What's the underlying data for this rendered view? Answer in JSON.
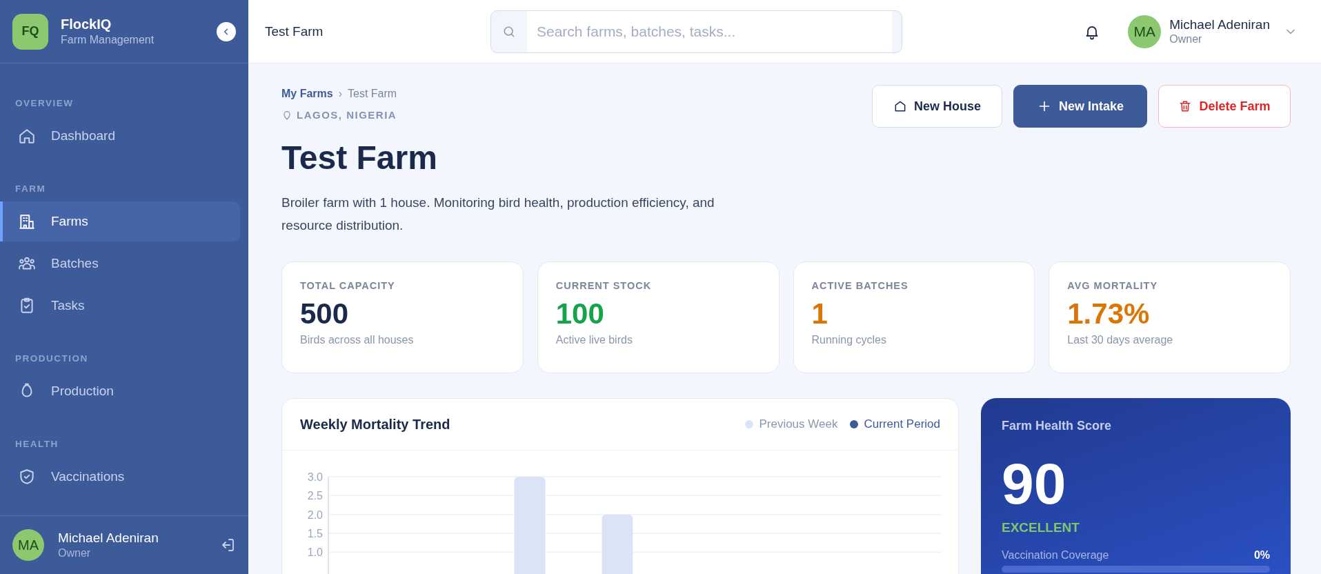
{
  "sidebar": {
    "brand": {
      "logo": "FQ",
      "name": "FlockIQ",
      "subtitle": "Farm Management"
    },
    "sections": [
      {
        "label": "OVERVIEW",
        "items": [
          {
            "label": "Dashboard",
            "selected": false
          }
        ]
      },
      {
        "label": "FARM",
        "items": [
          {
            "label": "Farms",
            "selected": true
          },
          {
            "label": "Batches",
            "selected": false
          },
          {
            "label": "Tasks",
            "selected": false
          }
        ]
      },
      {
        "label": "PRODUCTION",
        "items": [
          {
            "label": "Production",
            "selected": false
          }
        ]
      },
      {
        "label": "HEALTH",
        "items": [
          {
            "label": "Vaccinations",
            "selected": false
          }
        ]
      }
    ],
    "user": {
      "initials": "MA",
      "name": "Michael Adeniran",
      "role": "Owner"
    }
  },
  "topbar": {
    "title": "Test Farm",
    "search": {
      "placeholder": "Search farms, batches, tasks..."
    },
    "user": {
      "initials": "MA",
      "name": "Michael Adeniran",
      "role": "Owner"
    }
  },
  "page": {
    "breadcrumb": {
      "items": [
        "My Farms",
        "Test Farm"
      ],
      "separator": "›"
    },
    "location": "LAGOS, NIGERIA",
    "title": "Test Farm",
    "description": "Broiler farm with 1 house. Monitoring bird health, production efficiency, and resource distribution.",
    "actions": [
      {
        "label": "New House",
        "kind": "outline"
      },
      {
        "label": "New Intake",
        "kind": "primary"
      },
      {
        "label": "Delete Farm",
        "kind": "danger"
      }
    ]
  },
  "stats": [
    {
      "label": "TOTAL CAPACITY",
      "value": "500",
      "caption": "Birds across all houses",
      "color": "#1b2a4a"
    },
    {
      "label": "CURRENT STOCK",
      "value": "100",
      "caption": "Active live birds",
      "color": "#16a34a"
    },
    {
      "label": "ACTIVE BATCHES",
      "value": "1",
      "caption": "Running cycles",
      "color": "#d97706"
    },
    {
      "label": "AVG MORTALITY",
      "value": "1.73%",
      "caption": "Last 30 days average",
      "color": "#d97706"
    }
  ],
  "mortality_chart": {
    "title": "Weekly Mortality Trend",
    "chart_data": {
      "type": "bar",
      "grid": true,
      "series": [
        {
          "name": "Previous Week",
          "color": "#dbe3f6",
          "values": [
            0,
            0,
            3,
            2,
            0,
            0,
            0
          ]
        },
        {
          "name": "Current Period",
          "color": "#3d5a99",
          "values": [
            0,
            0,
            0,
            0,
            0,
            0,
            0
          ]
        }
      ],
      "ylim": [
        0,
        3
      ],
      "yticks": [
        {
          "value": 1,
          "label": "1.0"
        },
        {
          "value": 1.5,
          "label": "1.5"
        },
        {
          "value": 2,
          "label": "2.0"
        },
        {
          "value": 2.5,
          "label": "2.5"
        },
        {
          "value": 3,
          "label": "3.0"
        }
      ]
    }
  },
  "health": {
    "title": "Farm Health Score",
    "score": "90",
    "rating": "EXCELLENT",
    "metrics": [
      {
        "label": "Vaccination Coverage",
        "value": "0%",
        "level": 0
      }
    ]
  }
}
